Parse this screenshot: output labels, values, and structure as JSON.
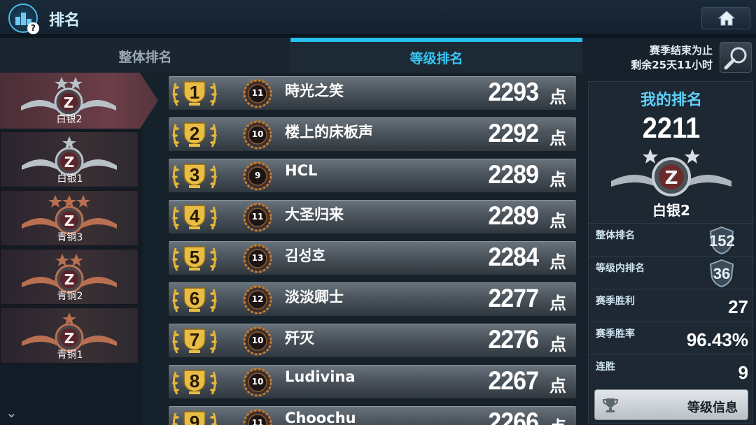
{
  "header": {
    "title": "排名",
    "icon": "ranking-podium-icon",
    "home_icon": "home-icon"
  },
  "tabs": [
    {
      "label": "整体排名",
      "active": false
    },
    {
      "label": "等级排名",
      "active": true
    }
  ],
  "left_ranks": [
    {
      "label": "白银2",
      "stars": 2,
      "tier": "silver",
      "selected": true
    },
    {
      "label": "白银1",
      "stars": 1,
      "tier": "silver",
      "selected": false
    },
    {
      "label": "青铜3",
      "stars": 3,
      "tier": "bronze",
      "selected": false
    },
    {
      "label": "青铜2",
      "stars": 2,
      "tier": "bronze",
      "selected": false
    },
    {
      "label": "青铜1",
      "stars": 1,
      "tier": "bronze",
      "selected": false
    }
  ],
  "ranking": [
    {
      "rank": "1",
      "level": "11",
      "name": "時光之笑",
      "score": "2293",
      "unit": "点"
    },
    {
      "rank": "2",
      "level": "10",
      "name": "楼上的床板声",
      "score": "2292",
      "unit": "点"
    },
    {
      "rank": "3",
      "level": "9",
      "name": "HCL",
      "score": "2289",
      "unit": "点"
    },
    {
      "rank": "4",
      "level": "11",
      "name": "大圣归来",
      "score": "2289",
      "unit": "点"
    },
    {
      "rank": "5",
      "level": "13",
      "name": "김성호",
      "score": "2284",
      "unit": "点"
    },
    {
      "rank": "6",
      "level": "12",
      "name": "淡淡卿士",
      "score": "2277",
      "unit": "点"
    },
    {
      "rank": "7",
      "level": "10",
      "name": "歼灭",
      "score": "2276",
      "unit": "点"
    },
    {
      "rank": "8",
      "level": "10",
      "name": "Ludivina",
      "score": "2267",
      "unit": "点"
    },
    {
      "rank": "9",
      "level": "11",
      "name": "Choochu",
      "score": "2266",
      "unit": "点"
    }
  ],
  "season": {
    "line1": "赛季结束为止",
    "line2": "剩余25天11小时"
  },
  "my_rank": {
    "title": "我的排名",
    "score": "2211",
    "tier": "白银2",
    "stars": 2,
    "stats": [
      {
        "label": "整体排名",
        "value": "152",
        "badge": true
      },
      {
        "label": "等级内排名",
        "value": "36",
        "badge": true
      },
      {
        "label": "赛季胜利",
        "value": "27",
        "badge": false
      },
      {
        "label": "赛季胜率",
        "value": "96.43%",
        "badge": false
      },
      {
        "label": "连胜",
        "value": "9",
        "badge": false
      }
    ],
    "tier_info_button": "等级信息"
  },
  "colors": {
    "accent": "#27bfee",
    "silver": "#c9d0d6",
    "bronze": "#c07a5a",
    "gold": "#e2b43c"
  }
}
